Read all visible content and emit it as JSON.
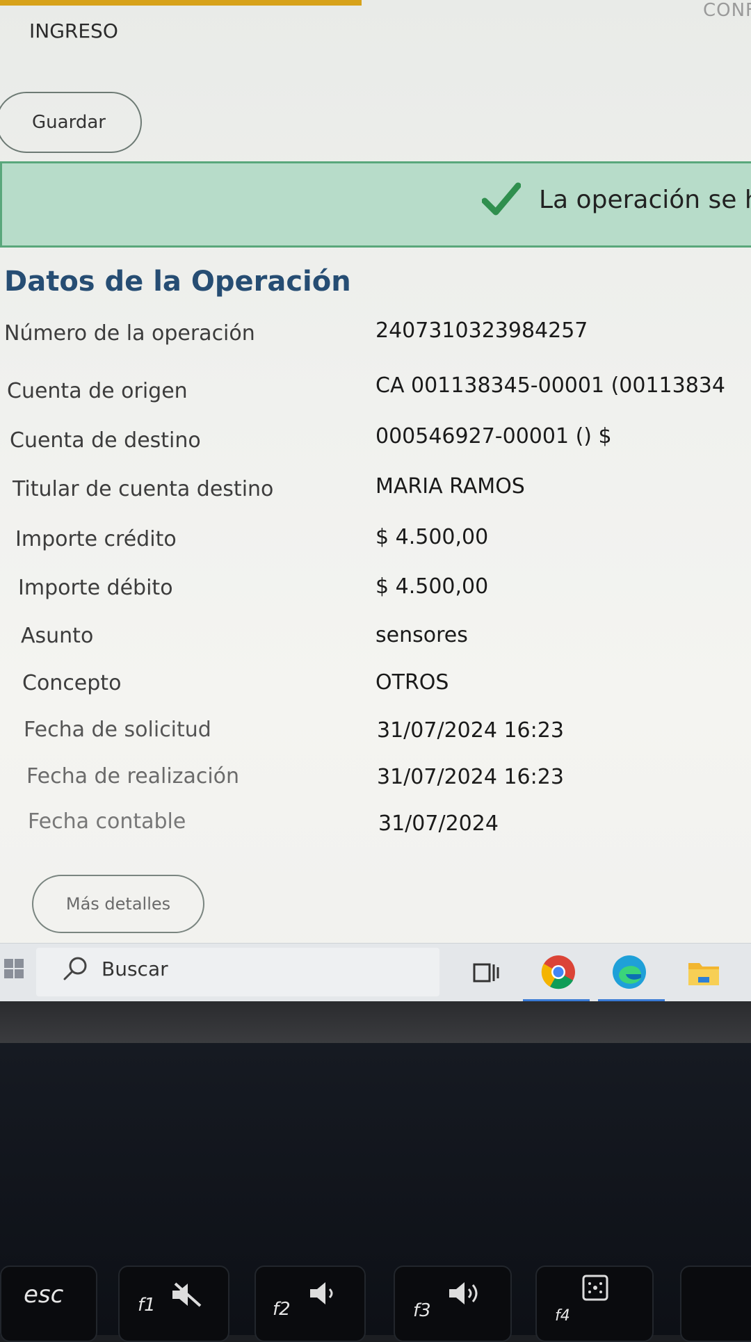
{
  "header": {
    "title": "INGRESO",
    "top_right": "CONF"
  },
  "actions": {
    "save_label": "Guardar",
    "more_details_label": "Más detalles"
  },
  "banner": {
    "message": "La operación se ha"
  },
  "section": {
    "title": "Datos de la Operación"
  },
  "details": [
    {
      "label": "Número de la operación",
      "value": "2407310323984257"
    },
    {
      "label": "Cuenta de origen",
      "value": "CA 001138345-00001 (00113834"
    },
    {
      "label": "Cuenta de destino",
      "value": "000546927-00001 () $"
    },
    {
      "label": "Titular de cuenta destino",
      "value": "MARIA RAMOS"
    },
    {
      "label": "Importe crédito",
      "value": "$ 4.500,00"
    },
    {
      "label": "Importe débito",
      "value": "$ 4.500,00"
    },
    {
      "label": "Asunto",
      "value": "sensores"
    },
    {
      "label": "Concepto",
      "value": "OTROS"
    },
    {
      "label": "Fecha de solicitud",
      "value": "31/07/2024 16:23"
    },
    {
      "label": "Fecha de realización",
      "value": "31/07/2024 16:23"
    },
    {
      "label": "Fecha contable",
      "value": "31/07/2024"
    }
  ],
  "taskbar": {
    "search_placeholder": "Buscar",
    "icons": [
      "windows-start-icon",
      "search-icon",
      "task-view-icon",
      "chrome-icon",
      "edge-icon",
      "file-explorer-icon"
    ]
  },
  "keyboard": {
    "keys": [
      {
        "label": "esc"
      },
      {
        "label": "f1"
      },
      {
        "label": "f2"
      },
      {
        "label": "f3"
      },
      {
        "label": "f4"
      }
    ]
  },
  "colors": {
    "banner_bg": "#b7dcc9",
    "banner_border": "#59a77b",
    "check": "#2f8f4e",
    "section_title": "#264d73"
  }
}
